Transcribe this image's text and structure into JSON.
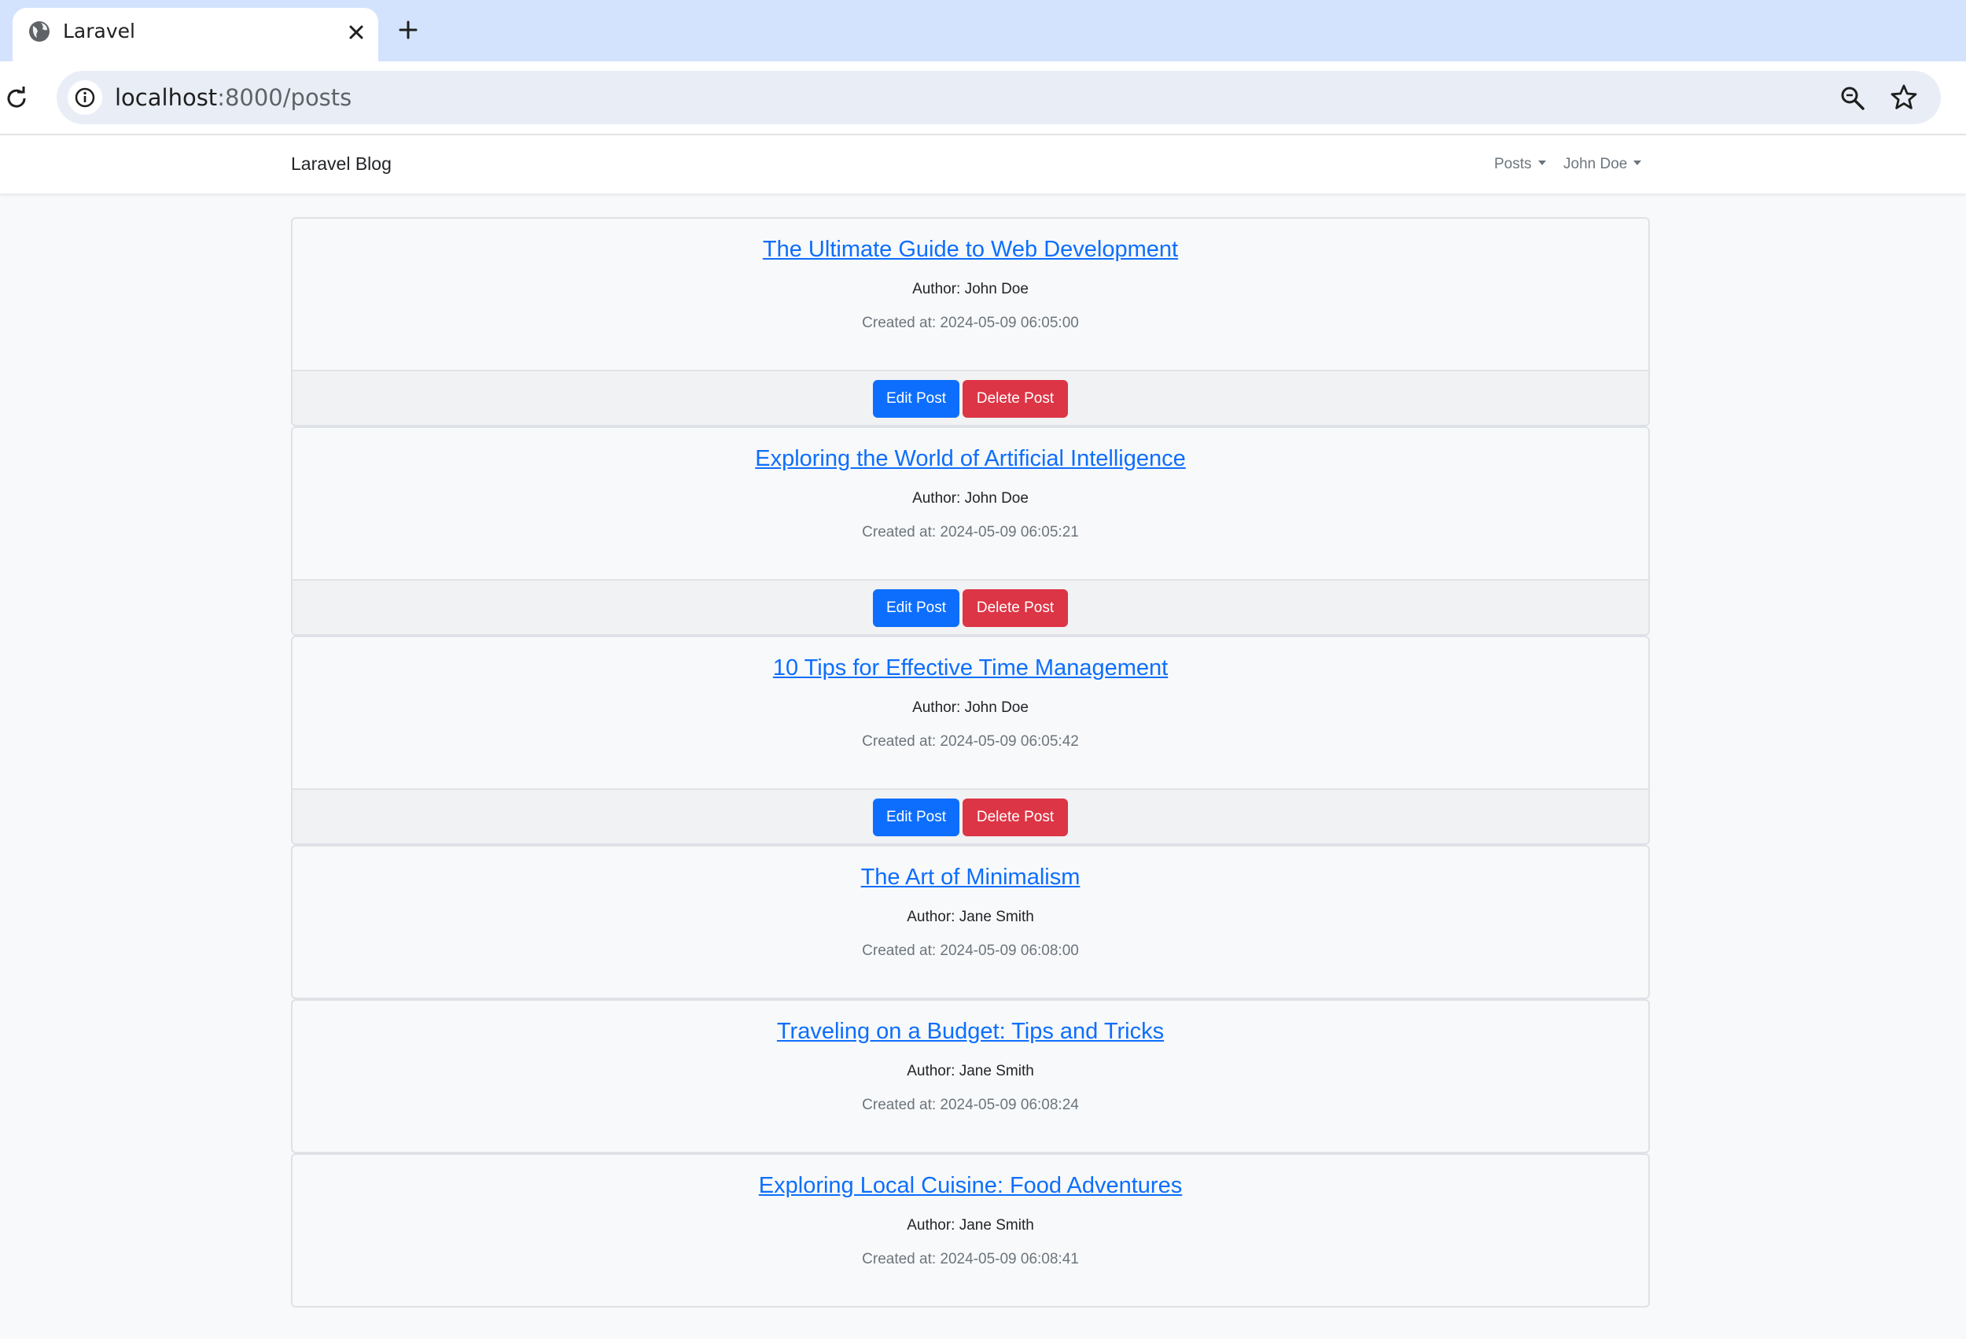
{
  "browser": {
    "tab_title": "Laravel",
    "url_host": "localhost",
    "url_rest": ":8000/posts"
  },
  "navbar": {
    "brand": "Laravel Blog",
    "posts_menu": "Posts",
    "user_menu": "John Doe"
  },
  "posts": [
    {
      "title": "The Ultimate Guide to Web Development",
      "author": "Author: John Doe",
      "created": "Created at: 2024-05-09 06:05:00",
      "edit_label": "Edit Post",
      "delete_label": "Delete Post"
    },
    {
      "title": "Exploring the World of Artificial Intelligence",
      "author": "Author: John Doe",
      "created": "Created at: 2024-05-09 06:05:21",
      "edit_label": "Edit Post",
      "delete_label": "Delete Post"
    },
    {
      "title": "10 Tips for Effective Time Management",
      "author": "Author: John Doe",
      "created": "Created at: 2024-05-09 06:05:42",
      "edit_label": "Edit Post",
      "delete_label": "Delete Post"
    },
    {
      "title": "The Art of Minimalism",
      "author": "Author: Jane Smith",
      "created": "Created at: 2024-05-09 06:08:00"
    },
    {
      "title": "Traveling on a Budget: Tips and Tricks",
      "author": "Author: Jane Smith",
      "created": "Created at: 2024-05-09 06:08:24"
    },
    {
      "title": "Exploring Local Cuisine: Food Adventures",
      "author": "Author: Jane Smith",
      "created": "Created at: 2024-05-09 06:08:41"
    }
  ],
  "colors": {
    "primary": "#0d6efd",
    "danger": "#dc3545",
    "tabstrip": "#d3e3fd"
  }
}
